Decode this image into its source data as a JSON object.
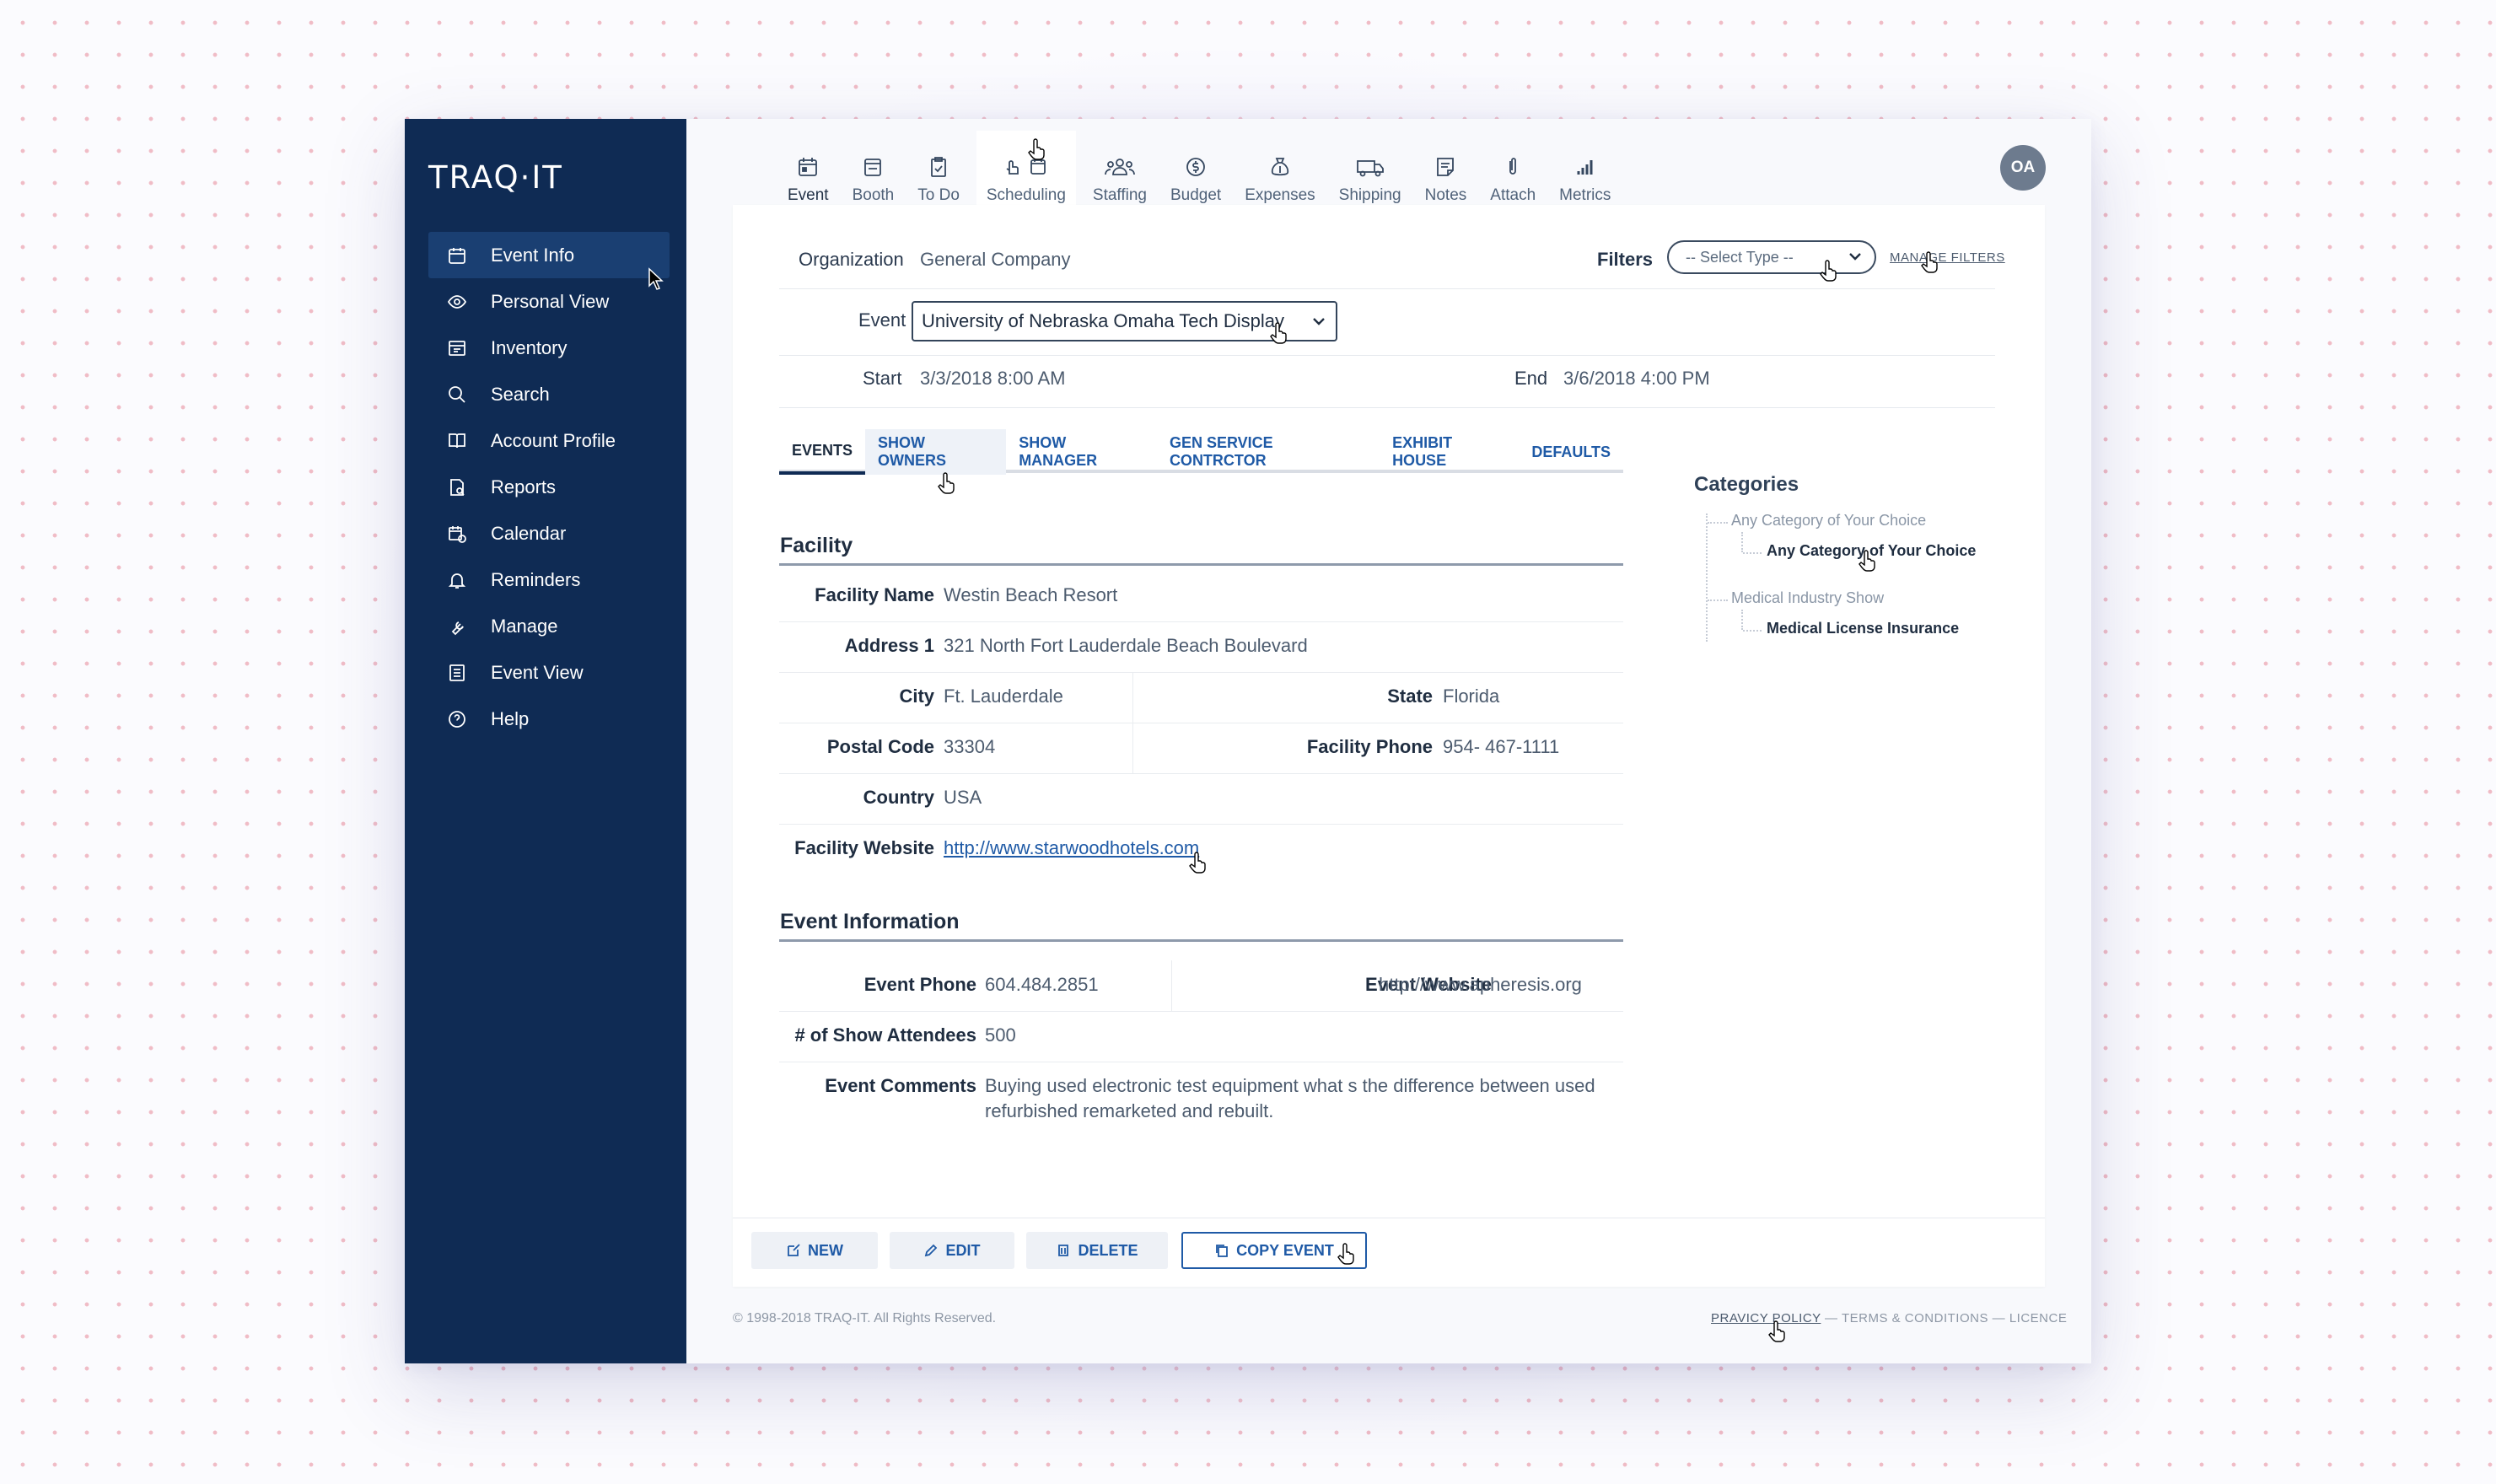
{
  "app": {
    "logo": "TRAQ·IT"
  },
  "sidebar": {
    "items": [
      {
        "label": "Event Info",
        "icon": "calendar-icon",
        "active": true
      },
      {
        "label": "Personal View",
        "icon": "eye-icon"
      },
      {
        "label": "Inventory",
        "icon": "inventory-icon"
      },
      {
        "label": "Search",
        "icon": "search-icon"
      },
      {
        "label": "Account Profile",
        "icon": "book-icon"
      },
      {
        "label": "Reports",
        "icon": "report-icon"
      },
      {
        "label": "Calendar",
        "icon": "calendar-clock-icon"
      },
      {
        "label": "Reminders",
        "icon": "bell-icon"
      },
      {
        "label": "Manage",
        "icon": "wrench-icon"
      },
      {
        "label": "Event View",
        "icon": "list-icon"
      },
      {
        "label": "Help",
        "icon": "help-icon"
      }
    ]
  },
  "top_tabs": [
    {
      "label": "Event",
      "icon": "calendar-icon",
      "active": true
    },
    {
      "label": "Booth",
      "icon": "booth-icon"
    },
    {
      "label": "To Do",
      "icon": "checklist-icon"
    },
    {
      "label": "Scheduling",
      "icon": "scheduling-icon",
      "hover": true
    },
    {
      "label": "Staffing",
      "icon": "people-icon"
    },
    {
      "label": "Budget",
      "icon": "budget-icon"
    },
    {
      "label": "Expenses",
      "icon": "money-bag-icon"
    },
    {
      "label": "Shipping",
      "icon": "truck-icon"
    },
    {
      "label": "Notes",
      "icon": "notes-icon"
    },
    {
      "label": "Attach",
      "icon": "paperclip-icon"
    },
    {
      "label": "Metrics",
      "icon": "bar-chart-icon"
    }
  ],
  "user": {
    "initials": "OA"
  },
  "header": {
    "organization_label": "Organization",
    "organization_value": "General Company",
    "filters_label": "Filters",
    "select_type_placeholder": "-- Select Type --",
    "manage_filters": "MANAGE FILTERS",
    "event_label": "Event",
    "event_value": "University of Nebraska Omaha Tech Display",
    "start_label": "Start",
    "start_value": "3/3/2018 8:00 AM",
    "end_label": "End",
    "end_value": "3/6/2018 4:00 PM"
  },
  "sub_tabs": [
    {
      "label": "EVENTS",
      "active": true
    },
    {
      "label": "SHOW OWNERS",
      "hover": true
    },
    {
      "label": "SHOW MANAGER"
    },
    {
      "label": "GEN SERVICE CONTRCTOR"
    },
    {
      "label": "EXHIBIT HOUSE"
    },
    {
      "label": "DEFAULTS"
    }
  ],
  "facility": {
    "title": "Facility",
    "name_label": "Facility Name",
    "name": "Westin Beach Resort",
    "address_label": "Address 1",
    "address": "321 North Fort Lauderdale Beach Boulevard",
    "city_label": "City",
    "city": "Ft. Lauderdale",
    "state_label": "State",
    "state": "Florida",
    "postal_label": "Postal Code",
    "postal": "33304",
    "phone_label": "Facility Phone",
    "phone": "954- 467-1111",
    "country_label": "Country",
    "country": "USA",
    "website_label": "Facility Website",
    "website": "http://www.starwoodhotels.com"
  },
  "event_info": {
    "title": "Event Information",
    "phone_label": "Event Phone",
    "phone": "604.484.2851",
    "website_label": "Event Website",
    "website": "http://www.apheresis.org",
    "attendees_label": "# of Show Attendees",
    "attendees": "500",
    "comments_label": "Event Comments",
    "comments_line1": "Buying used electronic test equipment what s the difference between used",
    "comments_line2": "refurbished remarketed and rebuilt."
  },
  "categories": {
    "title": "Categories",
    "groups": [
      {
        "parent": "Any Category of Your Choice",
        "child": "Any Category of Your Choice"
      },
      {
        "parent": "Medical Industry Show",
        "child": "Medical License Insurance"
      }
    ]
  },
  "actions": {
    "new": "NEW",
    "edit": "EDIT",
    "delete": "DELETE",
    "copy": "COPY EVENT"
  },
  "footer": {
    "copyright": "© 1998-2018 TRAQ-IT. All Rights Reserved.",
    "privacy": "PRAVICY POLICY",
    "sep1": " — ",
    "terms": "TERMS & CONDITIONS",
    "sep2": " — ",
    "licence": "LICENCE"
  }
}
